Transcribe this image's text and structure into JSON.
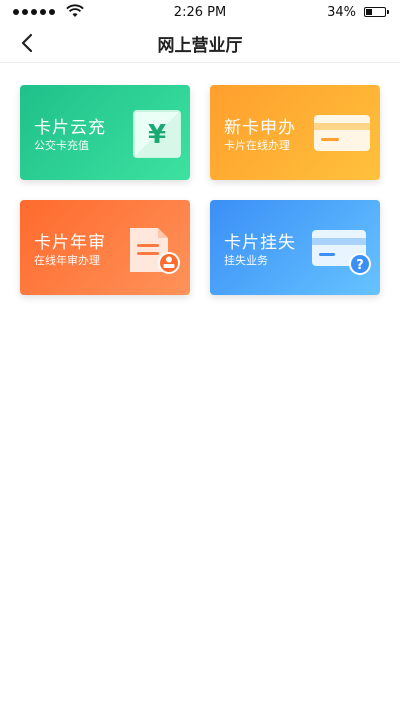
{
  "status": {
    "time": "2:26 PM",
    "battery": "34%",
    "battery_level": 0.34
  },
  "nav": {
    "title": "网上营业厅",
    "back_icon": "chevron-left-icon"
  },
  "cards": [
    {
      "title": "卡片云充",
      "subtitle": "公交卡充值",
      "icon": "yuan-icon",
      "color": "#25c98f"
    },
    {
      "title": "新卡申办",
      "subtitle": "卡片在线办理",
      "icon": "card-icon",
      "color": "#ffad33"
    },
    {
      "title": "卡片年审",
      "subtitle": "在线年审办理",
      "icon": "document-stamp-icon",
      "color": "#ff7535"
    },
    {
      "title": "卡片挂失",
      "subtitle": "挂失业务",
      "icon": "card-question-icon",
      "color": "#4aa3f9"
    }
  ]
}
